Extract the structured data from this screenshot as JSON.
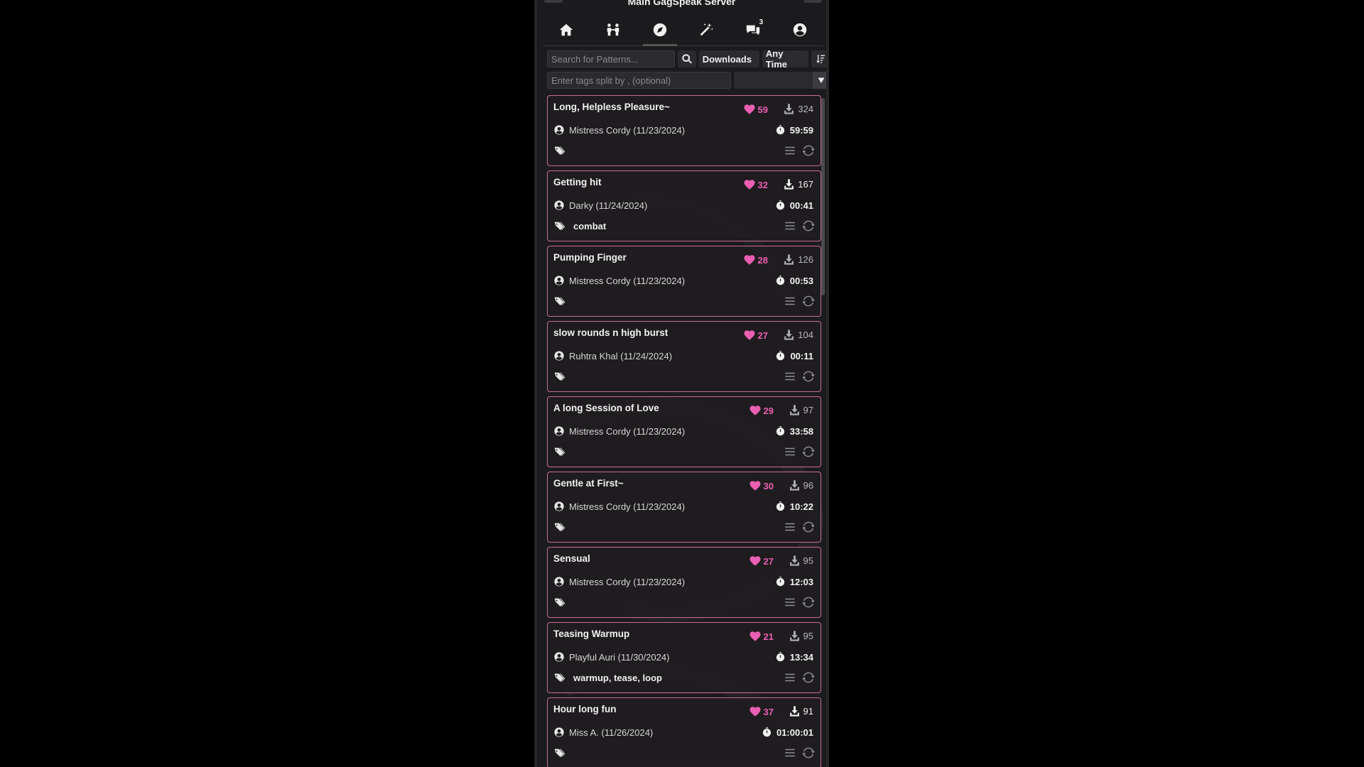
{
  "window": {
    "title": "Main GagSpeak Server"
  },
  "nav": {
    "items": [
      {
        "icon": "home-icon"
      },
      {
        "icon": "users-icon"
      },
      {
        "icon": "compass-icon",
        "active": true
      },
      {
        "icon": "magic-wand-icon"
      },
      {
        "icon": "chat-icon",
        "badge": "3"
      },
      {
        "icon": "account-icon"
      }
    ]
  },
  "search": {
    "placeholder": "Search for Patterns...",
    "value": "",
    "sort_label": "Downloads",
    "time_label": "Any Time"
  },
  "tags_filter": {
    "placeholder": "Enter tags split by , (optional)",
    "value": ""
  },
  "colors": {
    "accent_pink": "#ea5fb1",
    "card_border": "#c96c9a",
    "background": "#1b1b1d"
  },
  "patterns": [
    {
      "title": "Long, Helpless Pleasure~",
      "likes": "59",
      "downloads": "324",
      "author": "Mistress Cordy (11/23/2024)",
      "duration": "59:59",
      "tags": ""
    },
    {
      "title": "Getting hit",
      "likes": "32",
      "downloads": "167",
      "author": "Darky (11/24/2024)",
      "duration": "00:41",
      "tags": "combat"
    },
    {
      "title": "Pumping Finger",
      "likes": "28",
      "downloads": "126",
      "author": "Mistress Cordy (11/23/2024)",
      "duration": "00:53",
      "tags": ""
    },
    {
      "title": "slow rounds n high burst",
      "likes": "27",
      "downloads": "104",
      "author": "Ruhtra Khal (11/24/2024)",
      "duration": "00:11",
      "tags": ""
    },
    {
      "title": "A long Session of Love",
      "likes": "29",
      "downloads": "97",
      "author": "Mistress Cordy (11/23/2024)",
      "duration": "33:58",
      "tags": ""
    },
    {
      "title": "Gentle at First~",
      "likes": "30",
      "downloads": "96",
      "author": "Mistress Cordy (11/23/2024)",
      "duration": "10:22",
      "tags": ""
    },
    {
      "title": "Sensual",
      "likes": "27",
      "downloads": "95",
      "author": "Mistress Cordy (11/23/2024)",
      "duration": "12:03",
      "tags": ""
    },
    {
      "title": "Teasing Warmup",
      "likes": "21",
      "downloads": "95",
      "author": "Playful Auri (11/30/2024)",
      "duration": "13:34",
      "tags": "warmup, tease, loop"
    },
    {
      "title": "Hour long fun",
      "likes": "37",
      "downloads": "91",
      "author": "Miss A. (11/26/2024)",
      "duration": "01:00:01",
      "tags": ""
    }
  ]
}
